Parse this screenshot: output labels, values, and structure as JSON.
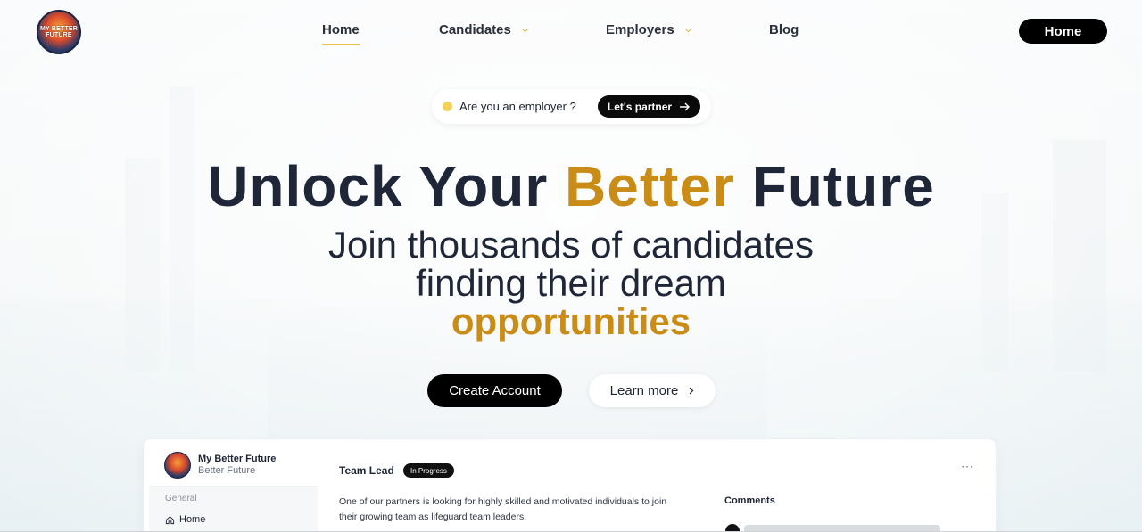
{
  "logo": {
    "line1": "MY BETTER",
    "line2": "FUTURE"
  },
  "nav": {
    "items": [
      {
        "label": "Home",
        "active": true
      },
      {
        "label": "Candidates",
        "dropdown": true
      },
      {
        "label": "Employers",
        "dropdown": true
      },
      {
        "label": "Blog"
      }
    ],
    "cta_label": "Home"
  },
  "employer_pill": {
    "text": "Are you an employer ?",
    "button_label": "Let's partner"
  },
  "hero": {
    "title_start": "Unlock Your ",
    "title_accent": "Better",
    "title_end": " Future",
    "subtitle_line1": "Join thousands of candidates",
    "subtitle_line2": "finding their dream",
    "subtitle_accent": "opportunities"
  },
  "buttons": {
    "primary": "Create Account",
    "secondary": "Learn more"
  },
  "dashboard": {
    "brand_name": "My Better Future",
    "brand_sub": "Better Future",
    "group_label": "General",
    "side_item": "Home",
    "job_title": "Team Lead",
    "status": "In Progress",
    "description": "One of our partners is looking for highly skilled and motivated individuals to join their growing team as lifeguard team leaders.",
    "comments_label": "Comments"
  },
  "colors": {
    "accent": "#c98c16",
    "dark": "#1e2638",
    "button": "#000000"
  }
}
